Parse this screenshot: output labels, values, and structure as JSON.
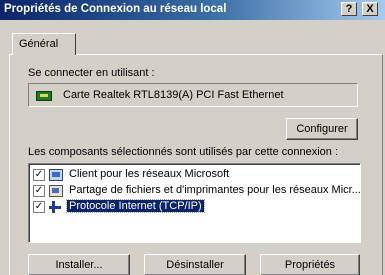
{
  "window": {
    "title": "Propriétés de Connexion au réseau local",
    "help_button": "?",
    "close_button": "X"
  },
  "tabs": [
    {
      "label": "Général",
      "selected": true
    }
  ],
  "connect_using": {
    "label": "Se connecter en utilisant :",
    "adapter_icon": "network-card-icon",
    "adapter_name": "Carte Realtek RTL8139(A) PCI Fast Ethernet"
  },
  "configure_button": "Configurer",
  "components": {
    "label": "Les composants sélectionnés sont utilisés par cette connexion :",
    "items": [
      {
        "label": "Client pour les réseaux Microsoft",
        "checked": true,
        "icon": "network-client-icon",
        "selected": false
      },
      {
        "label": "Partage de fichiers et d'imprimantes pour les réseaux Micr...",
        "checked": true,
        "icon": "file-printer-sharing-icon",
        "selected": false
      },
      {
        "label": "Protocole Internet (TCP/IP)",
        "checked": true,
        "icon": "protocol-icon",
        "selected": true
      }
    ]
  },
  "buttons": {
    "install": "Installer...",
    "uninstall": "Désinstaller",
    "properties": "Propriétés"
  },
  "colors": {
    "titlebar_start": "#0a246a",
    "titlebar_end": "#a6caf0",
    "face": "#d4d0c8",
    "selection": "#0a246a"
  }
}
